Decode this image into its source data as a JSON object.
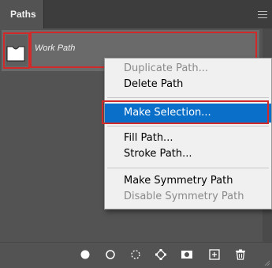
{
  "panel": {
    "tab_label": "Paths"
  },
  "path_row": {
    "name": "Work Path",
    "thumbnail_icon": "path-thumbnail"
  },
  "context_menu": {
    "items": [
      {
        "label": "Duplicate Path...",
        "enabled": false
      },
      {
        "label": "Delete Path",
        "enabled": true
      },
      {
        "label": "Make Selection...",
        "enabled": true,
        "selected": true
      },
      {
        "label": "Fill Path...",
        "enabled": true
      },
      {
        "label": "Stroke Path...",
        "enabled": true
      },
      {
        "label": "Make Symmetry Path",
        "enabled": true
      },
      {
        "label": "Disable Symmetry Path",
        "enabled": false
      }
    ]
  },
  "footer_icons": [
    "fill-path-icon",
    "stroke-path-icon",
    "load-selection-icon",
    "make-work-path-icon",
    "add-mask-icon",
    "new-path-icon",
    "delete-path-icon"
  ],
  "colors": {
    "panel_bg": "#535353",
    "header_bg": "#3d3d3d",
    "row_bg": "#6a6a6a",
    "menu_bg": "#f0f0f0",
    "selection_blue": "#0a6fc8",
    "highlight_red": "#d02a2a"
  }
}
